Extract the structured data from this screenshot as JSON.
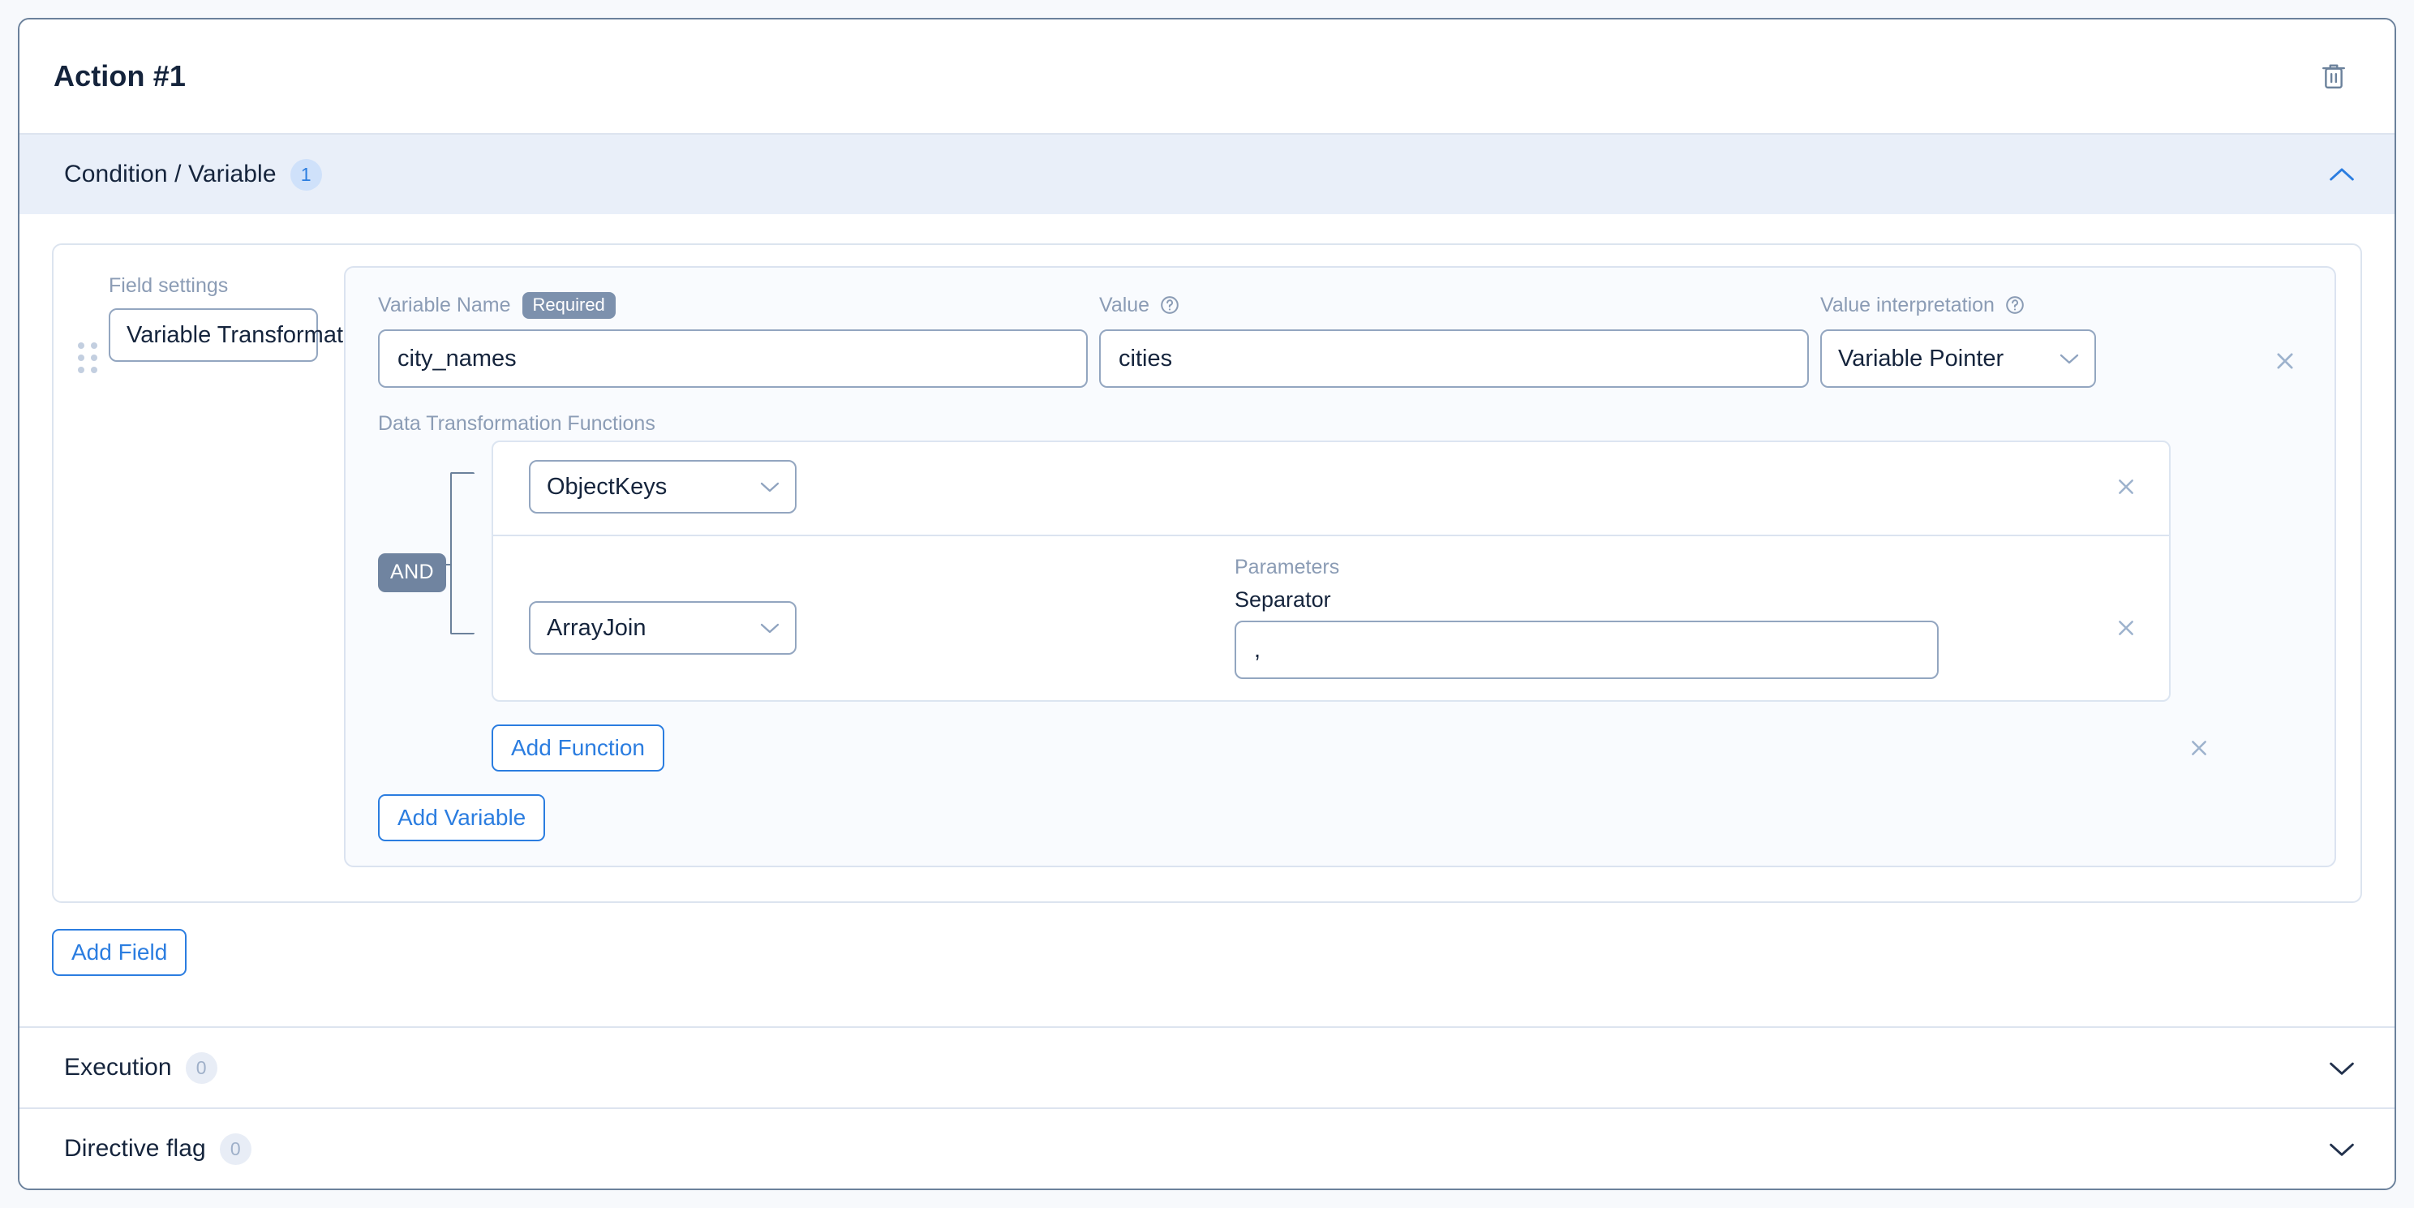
{
  "card": {
    "title": "Action #1",
    "delete_icon": "trash-icon"
  },
  "sections": [
    {
      "title": "Condition / Variable",
      "count": "1",
      "expanded": true,
      "chevron": "chevron-up-icon"
    },
    {
      "title": "Execution",
      "count": "0",
      "expanded": false,
      "chevron": "chevron-down-icon"
    },
    {
      "title": "Directive flag",
      "count": "0",
      "expanded": false,
      "chevron": "chevron-down-icon"
    }
  ],
  "field": {
    "settings_label": "Field settings",
    "type_select": {
      "value": "Variable Transformations",
      "chevron": "chevron-down-icon"
    },
    "drag_handle": "drag-handle-icon",
    "remove_icon": "close-icon"
  },
  "variable": {
    "name": {
      "label": "Variable Name",
      "required_badge": "Required",
      "value": "city_names",
      "placeholder": ""
    },
    "value": {
      "label": "Value",
      "help_icon": "help-circle-icon",
      "value": "cities",
      "placeholder": ""
    },
    "interpretation": {
      "label": "Value interpretation",
      "help_icon": "help-circle-icon",
      "value": "Variable Pointer",
      "chevron": "chevron-down-icon"
    },
    "remove_icon": "close-icon"
  },
  "transformations": {
    "label": "Data Transformation Functions",
    "operator": "AND",
    "functions": [
      {
        "name": "ObjectKeys",
        "chevron": "chevron-down-icon",
        "params_title": "",
        "param_label": "",
        "param_value": "",
        "remove_icon": "close-icon"
      },
      {
        "name": "ArrayJoin",
        "chevron": "chevron-down-icon",
        "params_title": "Parameters",
        "param_label": "Separator",
        "param_value": ",",
        "remove_icon": "close-icon"
      }
    ],
    "group_remove_icon": "close-icon",
    "add_function_label": "Add Function"
  },
  "buttons": {
    "add_variable": "Add Variable",
    "add_field": "Add Field"
  },
  "colors": {
    "accent_blue": "#2b7de0",
    "slate": "#7084a0",
    "header_bg": "#e9eff9",
    "border": "#6b819b"
  }
}
